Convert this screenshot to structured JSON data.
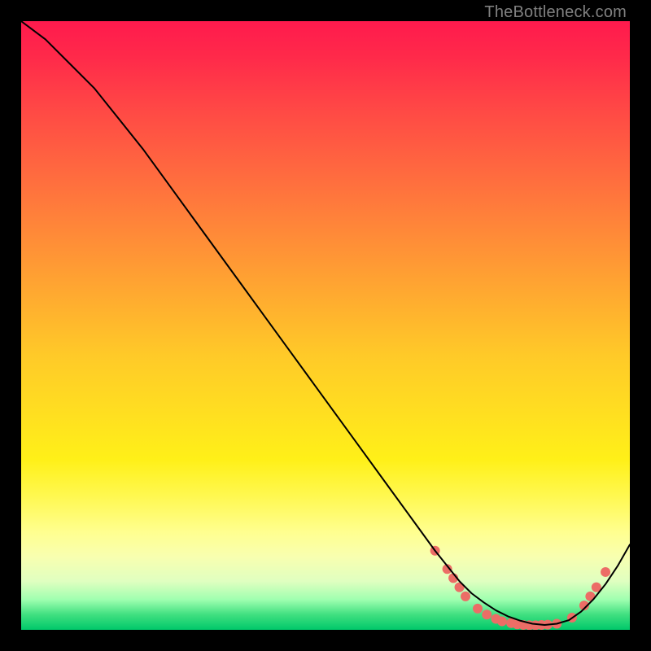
{
  "watermark": "TheBottleneck.com",
  "chart_data": {
    "type": "line",
    "title": "",
    "xlabel": "",
    "ylabel": "",
    "xlim": [
      0,
      100
    ],
    "ylim": [
      0,
      100
    ],
    "grid": false,
    "legend": false,
    "annotations": [],
    "series": [
      {
        "name": "curve",
        "color": "#000000",
        "x": [
          0,
          4,
          8,
          12,
          16,
          20,
          24,
          28,
          32,
          36,
          40,
          44,
          48,
          52,
          56,
          60,
          64,
          68,
          70,
          72,
          74,
          76,
          78,
          80,
          82,
          84,
          86,
          88,
          90,
          92,
          94,
          96,
          98,
          100
        ],
        "y": [
          100,
          97,
          93,
          89,
          84,
          79,
          73.5,
          68,
          62.5,
          57,
          51.5,
          46,
          40.5,
          35,
          29.5,
          24,
          18.5,
          13,
          10.5,
          8,
          6,
          4.5,
          3.2,
          2.2,
          1.5,
          1.0,
          0.8,
          1.0,
          1.6,
          3.0,
          5.0,
          7.5,
          10.5,
          14
        ]
      }
    ],
    "markers": [
      {
        "x": 68,
        "y": 13,
        "color": "#ec6d66"
      },
      {
        "x": 70,
        "y": 10,
        "color": "#ec6d66"
      },
      {
        "x": 71,
        "y": 8.5,
        "color": "#ec6d66"
      },
      {
        "x": 72,
        "y": 7,
        "color": "#ec6d66"
      },
      {
        "x": 73,
        "y": 5.5,
        "color": "#ec6d66"
      },
      {
        "x": 75,
        "y": 3.5,
        "color": "#ec6d66"
      },
      {
        "x": 76.5,
        "y": 2.5,
        "color": "#ec6d66"
      },
      {
        "x": 78,
        "y": 1.8,
        "color": "#ec6d66"
      },
      {
        "x": 79,
        "y": 1.4,
        "color": "#ec6d66"
      },
      {
        "x": 80.5,
        "y": 1.1,
        "color": "#ec6d66"
      },
      {
        "x": 81.5,
        "y": 0.9,
        "color": "#ec6d66"
      },
      {
        "x": 82.5,
        "y": 0.8,
        "color": "#ec6d66"
      },
      {
        "x": 83.5,
        "y": 0.75,
        "color": "#ec6d66"
      },
      {
        "x": 84.5,
        "y": 0.75,
        "color": "#ec6d66"
      },
      {
        "x": 85.5,
        "y": 0.8,
        "color": "#ec6d66"
      },
      {
        "x": 86.5,
        "y": 0.85,
        "color": "#ec6d66"
      },
      {
        "x": 88,
        "y": 1.0,
        "color": "#ec6d66"
      },
      {
        "x": 90.5,
        "y": 2.0,
        "color": "#ec6d66"
      },
      {
        "x": 92.5,
        "y": 4.0,
        "color": "#ec6d66"
      },
      {
        "x": 93.5,
        "y": 5.5,
        "color": "#ec6d66"
      },
      {
        "x": 94.5,
        "y": 7.0,
        "color": "#ec6d66"
      },
      {
        "x": 96,
        "y": 9.5,
        "color": "#ec6d66"
      }
    ]
  }
}
